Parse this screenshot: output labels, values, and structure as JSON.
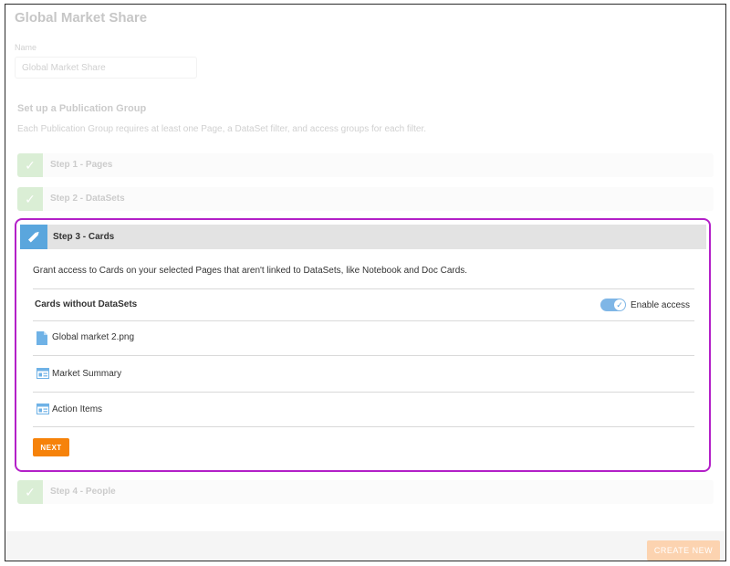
{
  "page": {
    "title": "Global Market Share",
    "name_label": "Name",
    "name_value": "Global Market Share"
  },
  "publication": {
    "title": "Set up a Publication Group",
    "description": "Each Publication Group requires at least one Page, a DataSet filter, and access groups for each filter."
  },
  "steps": [
    {
      "label": "Step 1 - Pages",
      "state": "complete"
    },
    {
      "label": "Step 2 - DataSets",
      "state": "complete"
    },
    {
      "label": "Step 3 - Cards",
      "state": "active"
    },
    {
      "label": "Step 4 - People",
      "state": "complete"
    }
  ],
  "step3": {
    "description": "Grant access to Cards on your selected Pages that aren't linked to DataSets, like Notebook and Doc Cards.",
    "cards_heading": "Cards without DataSets",
    "toggle_label": "Enable access",
    "toggle_on": true,
    "cards": [
      {
        "label": "Global market 2.png",
        "icon": "document-icon"
      },
      {
        "label": "Market Summary",
        "icon": "card-icon"
      },
      {
        "label": "Action Items",
        "icon": "card-icon"
      }
    ],
    "next_label": "NEXT"
  },
  "footer": {
    "create_label": "CREATE NEW"
  },
  "colors": {
    "highlight_border": "#b320c8",
    "step_complete": "#7cc36a",
    "step_active": "#5aa6dd",
    "next_button": "#f6820a",
    "toggle": "#7fb6e6"
  }
}
